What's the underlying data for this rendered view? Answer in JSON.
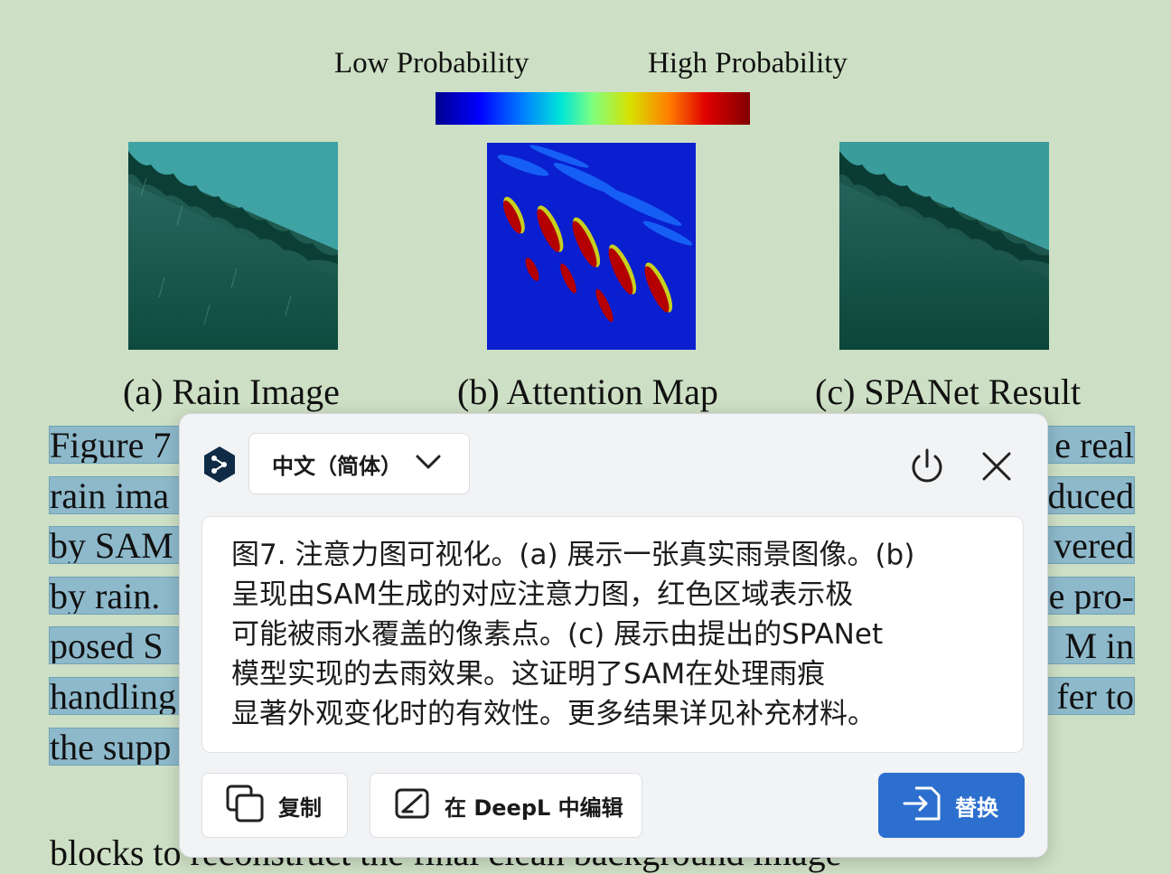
{
  "figure": {
    "colorbar": {
      "low_label": "Low Probability",
      "high_label": "High Probability"
    },
    "captions": {
      "a": "(a) Rain Image",
      "b": "(b) Attention Map",
      "c": "(c) SPANet Result"
    },
    "selected_lines_left": [
      "Figure 7",
      "rain ima",
      "by SAM",
      "by rain.",
      "posed S",
      "handling",
      "the supp"
    ],
    "selected_lines_right": [
      "e real",
      "duced",
      "vered",
      "e pro-",
      "M in",
      "fer to"
    ],
    "body_line": "blocks to reconstruct the final clean background image"
  },
  "popup": {
    "language": "中文（简体）",
    "translation_lines": [
      "图7. 注意力图可视化。(a) 展示一张真实雨景图像。(b)",
      "呈现由SAM生成的对应注意力图，红色区域表示极",
      "可能被雨水覆盖的像素点。(c) 展示由提出的SPANet",
      "模型实现的去雨效果。这证明了SAM在处理雨痕",
      "显著外观变化时的有效性。更多结果详见补充材料。"
    ],
    "copy_label": "复制",
    "edit_label": "在 DeepL 中编辑",
    "replace_label": "替换",
    "icons": [
      "deepl-logo-icon",
      "chevron-down-icon",
      "power-icon",
      "close-icon",
      "copy-icon",
      "edit-icon",
      "replace-icon"
    ],
    "colors": {
      "accent": "#2c6fce",
      "background": "#f2f3f5",
      "page": "#cddfc4",
      "selection": "#8db9cb"
    }
  }
}
